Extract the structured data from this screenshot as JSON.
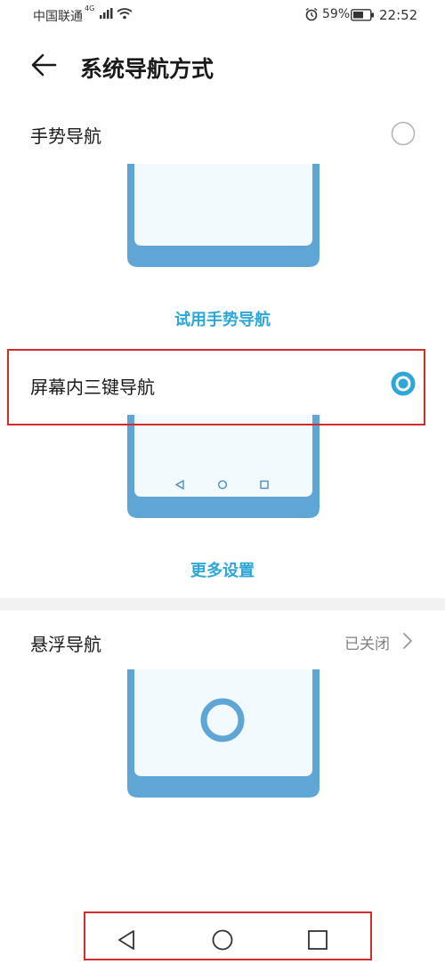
{
  "status_bar": {
    "carrier": "中国联通",
    "network": "4G",
    "battery": "59%",
    "time": "22:52"
  },
  "header": {
    "title": "系统导航方式",
    "back_icon": "back-arrow-icon"
  },
  "options": [
    {
      "label": "手势导航",
      "selected": false,
      "action": "试用手势导航"
    },
    {
      "label": "屏幕内三键导航",
      "selected": true,
      "action": "更多设置"
    }
  ],
  "floating": {
    "label": "悬浮导航",
    "value": "已关闭"
  },
  "colors": {
    "accent": "#2ea7d8",
    "phone_frame": "#5fa6d6",
    "phone_screen": "#f3fafd",
    "highlight": "#d42b2b"
  },
  "nav_bar": {
    "icons": [
      "back-triangle-icon",
      "home-circle-icon",
      "recents-square-icon"
    ]
  }
}
